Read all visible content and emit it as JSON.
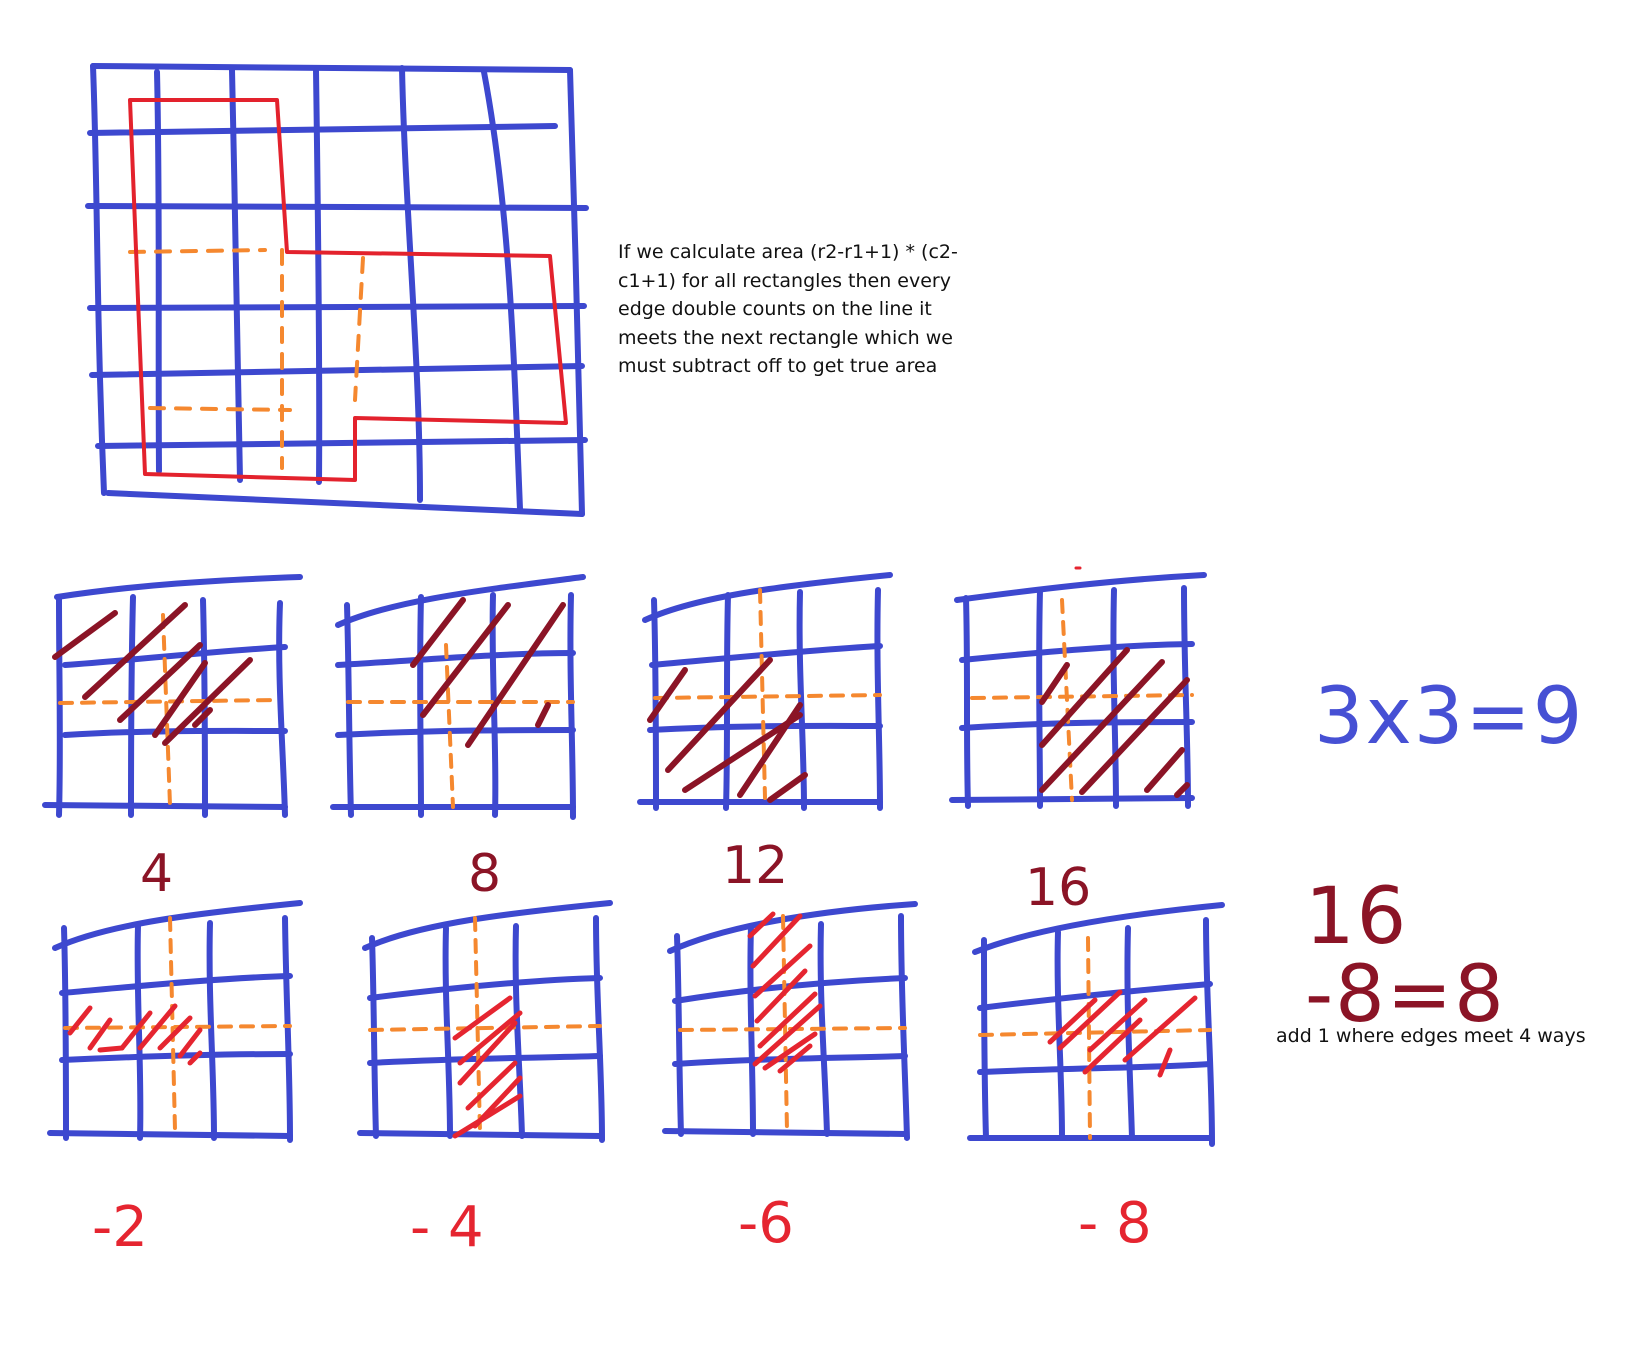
{
  "colors": {
    "grid": "#3d48cf",
    "outline": "#e3222d",
    "dash": "#f5882f",
    "hatch_dark": "#8b1426",
    "hatch_red": "#e52530"
  },
  "notes": {
    "main": "If we calculate area (r2-r1+1) * (c2-\nc1+1) for all rectangles then every\nedge double counts on the line it\nmeets the next rectangle which we\nmust subtract off to get true area",
    "add_one": "add 1 where edges meet 4 ways"
  },
  "panels_top": [
    {
      "label": "4",
      "hatch": "top-left"
    },
    {
      "label": "8",
      "hatch": "top-right"
    },
    {
      "label": "12",
      "hatch": "bottom-left"
    },
    {
      "label": "16",
      "hatch": "bottom-right"
    }
  ],
  "panels_bottom": [
    {
      "label": "-2",
      "hatch": "left-center-row"
    },
    {
      "label": "- 4",
      "hatch": "center-lower"
    },
    {
      "label": "-6",
      "hatch": "center-column"
    },
    {
      "label": "- 8",
      "hatch": "right-center-row"
    }
  ],
  "equations": {
    "blue": "3x3=9",
    "dark": "16 -8=8"
  }
}
